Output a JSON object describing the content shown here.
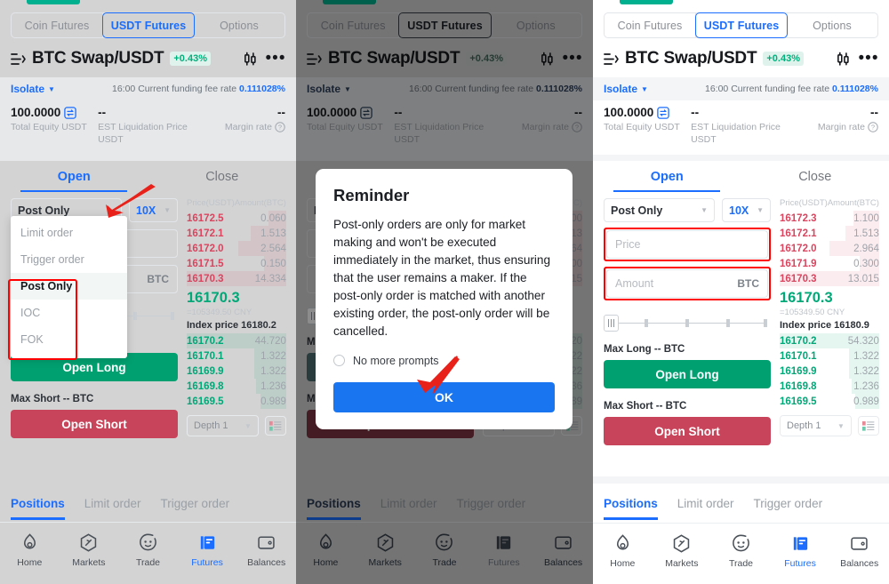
{
  "product_tabs": [
    {
      "label": "Coin Futures",
      "active": false
    },
    {
      "label": "USDT Futures",
      "active": true
    },
    {
      "label": "Options",
      "active": false
    }
  ],
  "pair": {
    "name": "BTC Swap/USDT",
    "change": "+0.43%",
    "margin_mode": "Isolate",
    "funding_prefix": "16:00 Current funding fee rate ",
    "funding_rate": "0.111028%"
  },
  "equity": {
    "total_value": "100.0000",
    "total_label": "Total Equity USDT",
    "liq_value": "--",
    "liq_label": "EST Liquidation Price USDT",
    "margin_value": "--",
    "margin_label": "Margin rate"
  },
  "open_close_tabs": [
    {
      "label": "Open",
      "active": true
    },
    {
      "label": "Close",
      "active": false
    }
  ],
  "form": {
    "order_type": "Post Only",
    "leverage": "10X",
    "price_placeholder": "Price",
    "amount_placeholder": "Amount",
    "amount_unit": "BTC",
    "max_long_label": "Max Long -- BTC",
    "max_short_label": "Max Short -- BTC",
    "open_long_label": "Open Long",
    "open_short_label": "Open Short"
  },
  "order_type_menu": {
    "items": [
      {
        "label": "Limit order",
        "selected": false
      },
      {
        "label": "Trigger order",
        "selected": false
      },
      {
        "label": "Post Only",
        "selected": true
      },
      {
        "label": "IOC",
        "selected": false
      },
      {
        "label": "FOK",
        "selected": false
      }
    ]
  },
  "orderbook": {
    "col_price": "Price(USDT)",
    "col_amount": "Amount(BTC)",
    "depth_label": "Depth 1",
    "panel1": {
      "asks": [
        {
          "price": "16172.5",
          "amount": "0.060",
          "bar": 18
        },
        {
          "price": "16172.1",
          "amount": "1.513",
          "bar": 36
        },
        {
          "price": "16172.0",
          "amount": "2.564",
          "bar": 48
        },
        {
          "price": "16171.5",
          "amount": "0.150",
          "bar": 22
        },
        {
          "price": "16170.3",
          "amount": "14.334",
          "bar": 100
        }
      ],
      "bids": [
        {
          "price": "16170.2",
          "amount": "44.720",
          "bar": 100
        },
        {
          "price": "16170.1",
          "amount": "1.322",
          "bar": 32
        },
        {
          "price": "16169.9",
          "amount": "1.322",
          "bar": 32
        },
        {
          "price": "16169.8",
          "amount": "1.236",
          "bar": 30
        },
        {
          "price": "16169.5",
          "amount": "0.989",
          "bar": 26
        }
      ],
      "last_price": "16170.3",
      "last_cny": "=105349.50 CNY",
      "index_price": "Index price 16180.2"
    },
    "panel3": {
      "asks": [
        {
          "price": "16172.3",
          "amount": "1.100",
          "bar": 26
        },
        {
          "price": "16172.1",
          "amount": "1.513",
          "bar": 34
        },
        {
          "price": "16172.0",
          "amount": "2.964",
          "bar": 50
        },
        {
          "price": "16171.9",
          "amount": "0.300",
          "bar": 20
        },
        {
          "price": "16170.3",
          "amount": "13.015",
          "bar": 100
        }
      ],
      "bids": [
        {
          "price": "16170.2",
          "amount": "54.320",
          "bar": 100
        },
        {
          "price": "16170.1",
          "amount": "1.322",
          "bar": 30
        },
        {
          "price": "16169.9",
          "amount": "1.322",
          "bar": 30
        },
        {
          "price": "16169.8",
          "amount": "1.236",
          "bar": 28
        },
        {
          "price": "16169.5",
          "amount": "0.989",
          "bar": 24
        }
      ],
      "last_price": "16170.3",
      "last_cny": "=105349.50 CNY",
      "index_price": "Index price 16180.9"
    }
  },
  "position_tabs": [
    {
      "label": "Positions",
      "active": true
    },
    {
      "label": "Limit order",
      "active": false
    },
    {
      "label": "Trigger order",
      "active": false
    }
  ],
  "bottom_nav": [
    {
      "label": "Home",
      "icon": "flame-icon",
      "active": false
    },
    {
      "label": "Markets",
      "icon": "compass-icon",
      "active": false
    },
    {
      "label": "Trade",
      "icon": "candle-face-icon",
      "active": false
    },
    {
      "label": "Futures",
      "icon": "futures-book-icon",
      "active": true
    },
    {
      "label": "Balances",
      "icon": "wallet-icon",
      "active": false
    }
  ],
  "modal": {
    "title": "Reminder",
    "body": "Post-only orders are only for market making and won't be executed immediately in the market, thus ensuring that the user remains a maker. If the post-only order is matched with another existing order, the post-only order will be cancelled.",
    "checkbox_label": "No more prompts",
    "ok_label": "OK"
  },
  "colors": {
    "accent_blue": "#1a6dff",
    "long_green": "#00a070",
    "short_red": "#c8445a",
    "ask_red": "#d9455f",
    "bid_green": "#00a878",
    "highlight_red": "#ff0000",
    "modal_button_blue": "#1a75f0"
  }
}
